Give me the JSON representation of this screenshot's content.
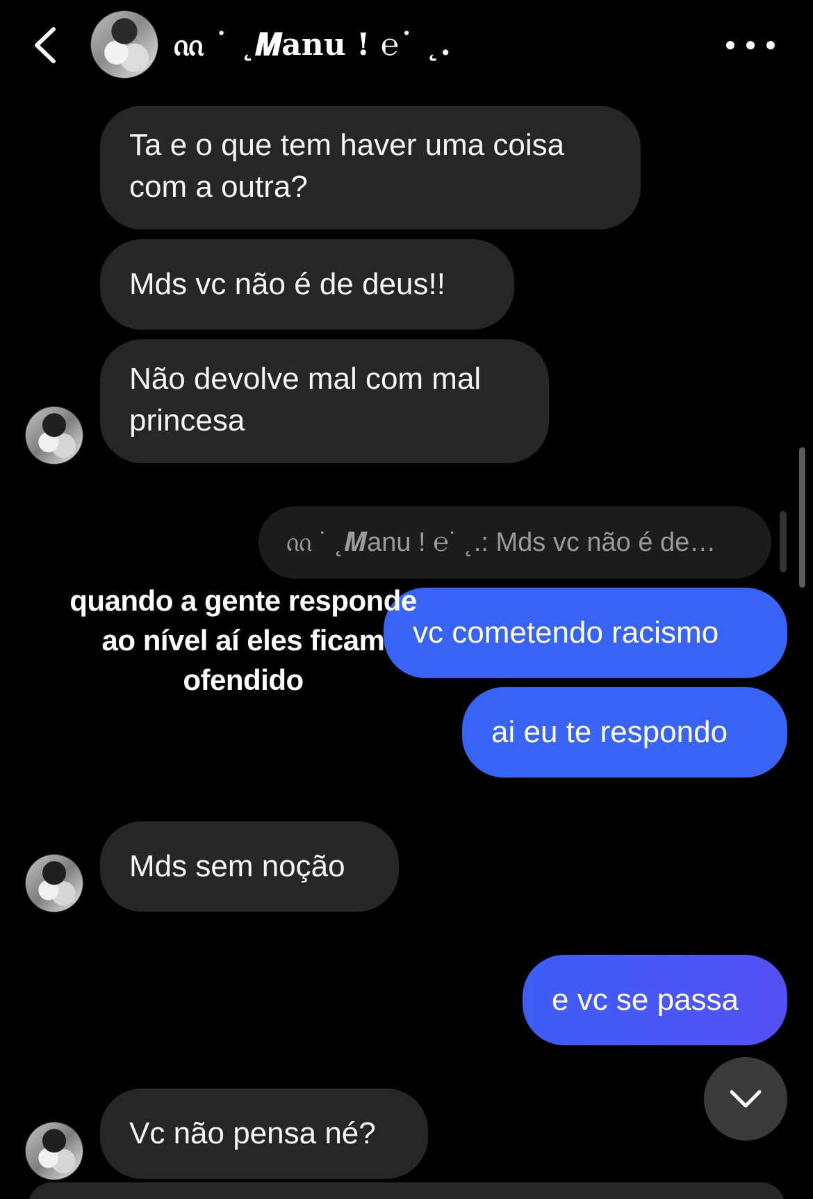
{
  "header": {
    "contact_name": "ᦶ ˙ ˛𝑴anu ! ℮˙ ˛.",
    "back_icon": "chevron-left-icon",
    "more_icon": "more-horizontal-icon"
  },
  "messages": [
    {
      "direction": "received",
      "lines": [
        "Ta e o que tem haver uma coisa",
        "com a outra?"
      ]
    },
    {
      "direction": "received",
      "lines": [
        "Mds vc não é de deus!!"
      ]
    },
    {
      "direction": "received",
      "lines": [
        "Não devolve mal com mal",
        "princesa"
      ]
    },
    {
      "direction": "sent",
      "reply_to": "ᦶ ˙ ˛𝑴anu ! ℮˙ ˛.: Mds vc não é de…",
      "lines": [
        "vc cometendo racismo"
      ]
    },
    {
      "direction": "sent",
      "lines": [
        "ai eu te respondo"
      ]
    },
    {
      "direction": "received",
      "lines": [
        "Mds sem noção"
      ]
    },
    {
      "direction": "sent",
      "lines": [
        "e vc se passa"
      ]
    },
    {
      "direction": "received",
      "lines": [
        "Vc não pensa né?"
      ]
    }
  ],
  "overlay_caption": [
    "quando a gente responde",
    "ao nível aí eles ficam",
    "ofendido"
  ],
  "scroll_down_icon": "chevron-down-icon",
  "colors": {
    "background": "#000000",
    "received_bubble": "#262626",
    "sent_bubble": "#3764f5",
    "sent_bubble_last": "#4a55f5",
    "reply_preview": "#1c1c1c"
  }
}
